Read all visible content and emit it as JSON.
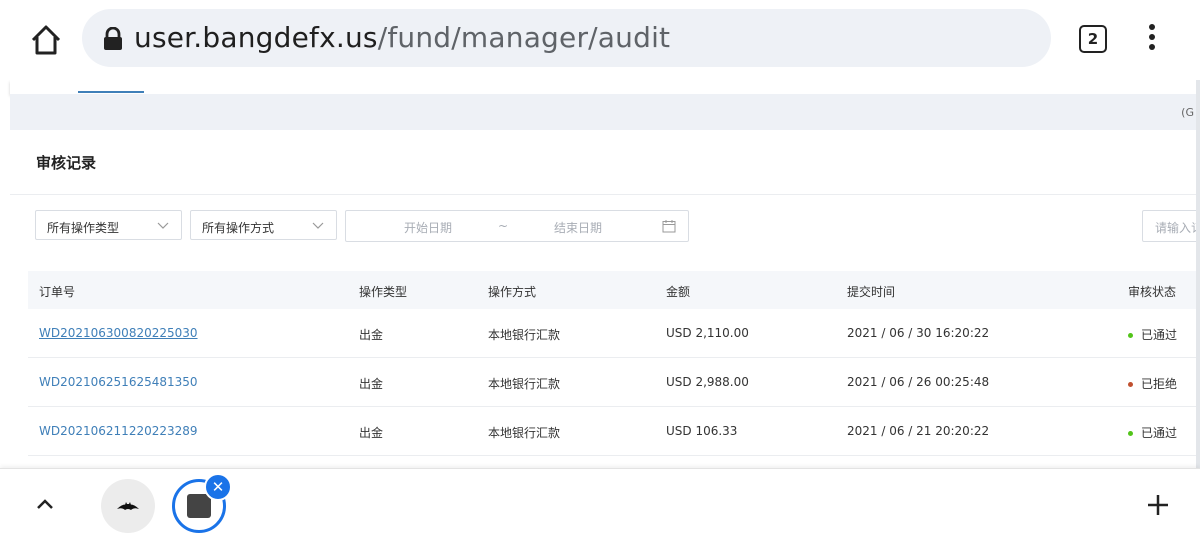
{
  "browser": {
    "url_host": "user.bangdefx.us",
    "url_path": "/fund/manager/audit",
    "tab_count": "2"
  },
  "page": {
    "band_text": "(G",
    "card_title": "审核记录"
  },
  "filters": {
    "operation_type": "所有操作类型",
    "operation_method": "所有操作方式",
    "start_date_placeholder": "开始日期",
    "range_separator": "~",
    "end_date_placeholder": "结束日期",
    "search_placeholder": "请输入订"
  },
  "table": {
    "headers": [
      "订单号",
      "操作类型",
      "操作方式",
      "金额",
      "提交时间",
      "审核状态"
    ],
    "rows": [
      {
        "order_no": "WD202106300820225030",
        "type": "出金",
        "method": "本地银行汇款",
        "amount": "USD 2,110.00",
        "time": "2021 / 06 / 30 16:20:22",
        "status": "已通过",
        "status_color": "#52c41a"
      },
      {
        "order_no": "WD202106251625481350",
        "type": "出金",
        "method": "本地银行汇款",
        "amount": "USD 2,988.00",
        "time": "2021 / 06 / 26 00:25:48",
        "status": "已拒绝",
        "status_color": "#c0502f"
      },
      {
        "order_no": "WD202106211220223289",
        "type": "出金",
        "method": "本地银行汇款",
        "amount": "USD 106.33",
        "time": "2021 / 06 / 21 20:20:22",
        "status": "已通过",
        "status_color": "#52c41a"
      }
    ]
  },
  "colors": {
    "link": "#3f7fb8",
    "accent_blue": "#1a73e8"
  }
}
